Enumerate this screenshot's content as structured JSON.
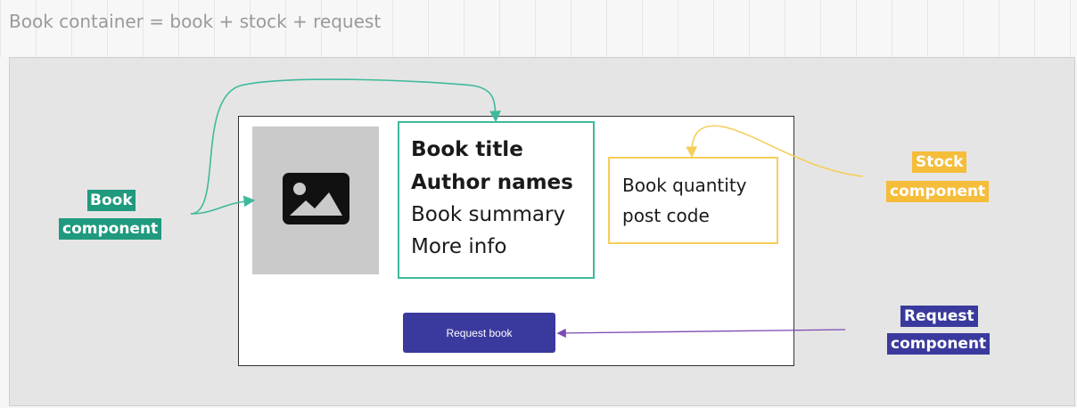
{
  "caption": "Book container = book + stock + request",
  "book_info": {
    "title": "Book title",
    "authors": "Author names",
    "summary": "Book summary",
    "more": "More info"
  },
  "stock_info": {
    "quantity": "Book quantity",
    "postcode": "post code"
  },
  "request_button": "Request book",
  "labels": {
    "book": [
      "Book",
      "component"
    ],
    "stock": [
      "Stock",
      "component"
    ],
    "request": [
      "Request",
      "component"
    ]
  },
  "colors": {
    "book": "#1f9a7e",
    "stock": "#f5bd3a",
    "request": "#3a3a9e"
  },
  "icons": {
    "image": "image-placeholder-icon"
  }
}
